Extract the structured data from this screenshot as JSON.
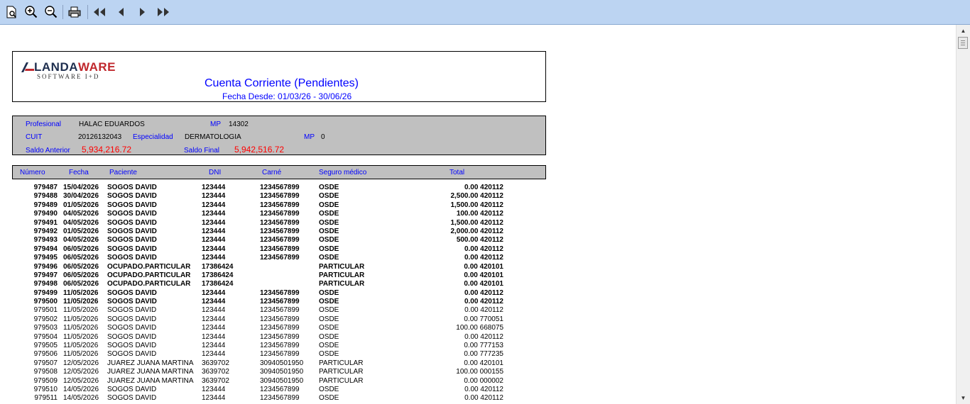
{
  "toolbar": {
    "buttons": [
      {
        "name": "page-setup-icon"
      },
      {
        "name": "zoom-in-icon"
      },
      {
        "name": "zoom-out-icon"
      },
      {
        "name": "print-icon"
      },
      {
        "name": "first-page-icon"
      },
      {
        "name": "previous-page-icon"
      },
      {
        "name": "next-page-icon"
      },
      {
        "name": "last-page-icon"
      }
    ]
  },
  "report": {
    "logo_main_dark": "LANDA",
    "logo_main_red": "WARE",
    "logo_sub": "SOFTWARE I+D",
    "title": "Cuenta Corriente (Pendientes)",
    "date_range": "Fecha Desde: 01/03/26 - 30/06/26"
  },
  "info": {
    "profesional_label": "Profesional",
    "profesional_value": "HALAC EDUARDOS",
    "mp_label": "MP",
    "mp_value": "14302",
    "cuit_label": "CUIT",
    "cuit_value": "20126132043",
    "especialidad_label": "Especialidad",
    "especialidad_value": "DERMATOLOGIA",
    "mp2_label": "MP",
    "mp2_value": "0",
    "saldo_anterior_label": "Saldo Anterior",
    "saldo_anterior_value": "5,934,216.72",
    "saldo_final_label": "Saldo Final",
    "saldo_final_value": "5,942,516.72"
  },
  "columns": {
    "numero": "Número",
    "fecha": "Fecha",
    "paciente": "Paciente",
    "dni": "DNI",
    "carne": "Carné",
    "seguro": "Seguro médico",
    "total": "Total"
  },
  "rows": [
    {
      "bold": true,
      "numero": "979487",
      "fecha": "15/04/2026",
      "paciente": "SOGOS DAVID",
      "dni": "123444",
      "carne": "1234567899",
      "seguro": "OSDE",
      "total": "0.00 420112"
    },
    {
      "bold": true,
      "numero": "979488",
      "fecha": "30/04/2026",
      "paciente": "SOGOS DAVID",
      "dni": "123444",
      "carne": "1234567899",
      "seguro": "OSDE",
      "total": "2,500.00 420112"
    },
    {
      "bold": true,
      "numero": "979489",
      "fecha": "01/05/2026",
      "paciente": "SOGOS DAVID",
      "dni": "123444",
      "carne": "1234567899",
      "seguro": "OSDE",
      "total": "1,500.00 420112"
    },
    {
      "bold": true,
      "numero": "979490",
      "fecha": "04/05/2026",
      "paciente": "SOGOS DAVID",
      "dni": "123444",
      "carne": "1234567899",
      "seguro": "OSDE",
      "total": "100.00 420112"
    },
    {
      "bold": true,
      "numero": "979491",
      "fecha": "04/05/2026",
      "paciente": "SOGOS DAVID",
      "dni": "123444",
      "carne": "1234567899",
      "seguro": "OSDE",
      "total": "1,500.00 420112"
    },
    {
      "bold": true,
      "numero": "979492",
      "fecha": "01/05/2026",
      "paciente": "SOGOS DAVID",
      "dni": "123444",
      "carne": "1234567899",
      "seguro": "OSDE",
      "total": "2,000.00 420112"
    },
    {
      "bold": true,
      "numero": "979493",
      "fecha": "04/05/2026",
      "paciente": "SOGOS DAVID",
      "dni": "123444",
      "carne": "1234567899",
      "seguro": "OSDE",
      "total": "500.00 420112"
    },
    {
      "bold": true,
      "numero": "979494",
      "fecha": "06/05/2026",
      "paciente": "SOGOS DAVID",
      "dni": "123444",
      "carne": "1234567899",
      "seguro": "OSDE",
      "total": "0.00 420112"
    },
    {
      "bold": true,
      "numero": "979495",
      "fecha": "06/05/2026",
      "paciente": "SOGOS DAVID",
      "dni": "123444",
      "carne": "1234567899",
      "seguro": "OSDE",
      "total": "0.00 420112"
    },
    {
      "bold": true,
      "numero": "979496",
      "fecha": "06/05/2026",
      "paciente": "OCUPADO.PARTICULAR",
      "dni": "17386424",
      "carne": "",
      "seguro": "PARTICULAR",
      "total": "0.00 420101"
    },
    {
      "bold": true,
      "numero": "979497",
      "fecha": "06/05/2026",
      "paciente": "OCUPADO.PARTICULAR",
      "dni": "17386424",
      "carne": "",
      "seguro": "PARTICULAR",
      "total": "0.00 420101"
    },
    {
      "bold": true,
      "numero": "979498",
      "fecha": "06/05/2026",
      "paciente": "OCUPADO.PARTICULAR",
      "dni": "17386424",
      "carne": "",
      "seguro": "PARTICULAR",
      "total": "0.00 420101"
    },
    {
      "bold": true,
      "numero": "979499",
      "fecha": "11/05/2026",
      "paciente": "SOGOS DAVID",
      "dni": "123444",
      "carne": "1234567899",
      "seguro": "OSDE",
      "total": "0.00 420112"
    },
    {
      "bold": true,
      "numero": "979500",
      "fecha": "11/05/2026",
      "paciente": "SOGOS DAVID",
      "dni": "123444",
      "carne": "1234567899",
      "seguro": "OSDE",
      "total": "0.00 420112"
    },
    {
      "bold": false,
      "numero": "979501",
      "fecha": "11/05/2026",
      "paciente": "SOGOS DAVID",
      "dni": "123444",
      "carne": "1234567899",
      "seguro": "OSDE",
      "total": "0.00 420112"
    },
    {
      "bold": false,
      "numero": "979502",
      "fecha": "11/05/2026",
      "paciente": "SOGOS DAVID",
      "dni": "123444",
      "carne": "1234567899",
      "seguro": "OSDE",
      "total": "0.00 770051"
    },
    {
      "bold": false,
      "numero": "979503",
      "fecha": "11/05/2026",
      "paciente": "SOGOS DAVID",
      "dni": "123444",
      "carne": "1234567899",
      "seguro": "OSDE",
      "total": "100.00 668075"
    },
    {
      "bold": false,
      "numero": "979504",
      "fecha": "11/05/2026",
      "paciente": "SOGOS DAVID",
      "dni": "123444",
      "carne": "1234567899",
      "seguro": "OSDE",
      "total": "0.00 420112"
    },
    {
      "bold": false,
      "numero": "979505",
      "fecha": "11/05/2026",
      "paciente": "SOGOS DAVID",
      "dni": "123444",
      "carne": "1234567899",
      "seguro": "OSDE",
      "total": "0.00 777153"
    },
    {
      "bold": false,
      "numero": "979506",
      "fecha": "11/05/2026",
      "paciente": "SOGOS DAVID",
      "dni": "123444",
      "carne": "1234567899",
      "seguro": "OSDE",
      "total": "0.00 777235"
    },
    {
      "bold": false,
      "numero": "979507",
      "fecha": "12/05/2026",
      "paciente": "JUAREZ JUANA MARTINA",
      "dni": "3639702",
      "carne": "30940501950",
      "seguro": "PARTICULAR",
      "total": "0.00 420101"
    },
    {
      "bold": false,
      "numero": "979508",
      "fecha": "12/05/2026",
      "paciente": "JUAREZ JUANA MARTINA",
      "dni": "3639702",
      "carne": "30940501950",
      "seguro": "PARTICULAR",
      "total": "100.00 000155"
    },
    {
      "bold": false,
      "numero": "979509",
      "fecha": "12/05/2026",
      "paciente": "JUAREZ JUANA MARTINA",
      "dni": "3639702",
      "carne": "30940501950",
      "seguro": "PARTICULAR",
      "total": "0.00 000002"
    },
    {
      "bold": false,
      "numero": "979510",
      "fecha": "14/05/2026",
      "paciente": "SOGOS DAVID",
      "dni": "123444",
      "carne": "1234567899",
      "seguro": "OSDE",
      "total": "0.00 420112"
    },
    {
      "bold": false,
      "numero": "979511",
      "fecha": "14/05/2026",
      "paciente": "SOGOS DAVID",
      "dni": "123444",
      "carne": "1234567899",
      "seguro": "OSDE",
      "total": "0.00 420112"
    }
  ]
}
